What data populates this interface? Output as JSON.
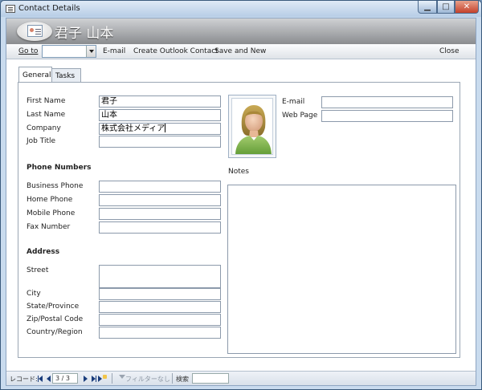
{
  "window": {
    "title": "Contact Details",
    "min_glyph": "▁",
    "max_glyph": "□",
    "close_glyph": "✕"
  },
  "header": {
    "contact_name": "君子 山本"
  },
  "toolbar": {
    "goto_label": "Go to",
    "goto_value": "",
    "email_label": "E-mail",
    "outlook_label": "Create Outlook Contact",
    "save_new_label": "Save and New",
    "close_label": "Close"
  },
  "tabs": [
    {
      "label": "General",
      "active": true
    },
    {
      "label": "Tasks",
      "active": false
    }
  ],
  "general": {
    "first_name_label": "First Name",
    "first_name_value": "君子",
    "last_name_label": "Last Name",
    "last_name_value": "山本",
    "company_label": "Company",
    "company_value": "株式会社メディア",
    "job_title_label": "Job Title",
    "job_title_value": "",
    "email_label": "E-mail",
    "email_value": "",
    "web_page_label": "Web Page",
    "web_page_value": "",
    "notes_label": "Notes",
    "notes_value": ""
  },
  "phone_numbers": {
    "heading": "Phone Numbers",
    "business_label": "Business Phone",
    "home_label": "Home Phone",
    "mobile_label": "Mobile Phone",
    "fax_label": "Fax Number",
    "business_value": "",
    "home_value": "",
    "mobile_value": "",
    "fax_value": ""
  },
  "address": {
    "heading": "Address",
    "street_label": "Street",
    "city_label": "City",
    "state_label": "State/Province",
    "zip_label": "Zip/Postal Code",
    "country_label": "Country/Region",
    "street_value": "",
    "city_value": "",
    "state_value": "",
    "zip_value": "",
    "country_value": ""
  },
  "statusbar": {
    "record_label": "レコード:",
    "record_counter": "3 / 3",
    "filter_label": "フィルターなし",
    "search_label": "検索",
    "search_value": ""
  },
  "colors": {
    "window_border": "#3b5a7c",
    "header_dark": "#8a8c8f",
    "nav_arrow": "#1a3d7c"
  }
}
